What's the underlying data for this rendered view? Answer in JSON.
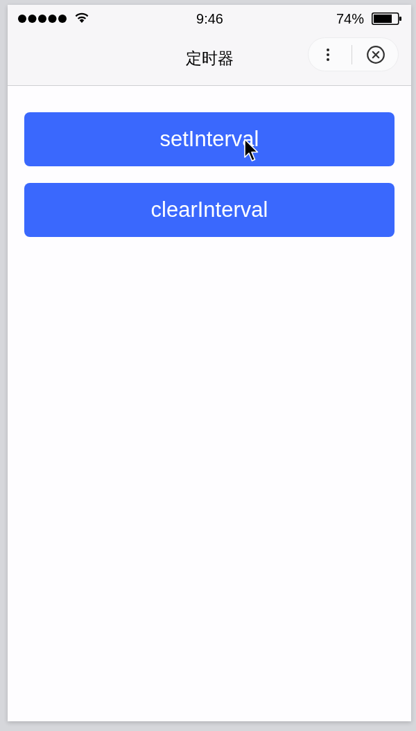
{
  "status_bar": {
    "time": "9:46",
    "battery": "74%"
  },
  "nav_bar": {
    "title": "定时器"
  },
  "buttons": [
    {
      "label": "setInterval"
    },
    {
      "label": "clearInterval"
    }
  ]
}
